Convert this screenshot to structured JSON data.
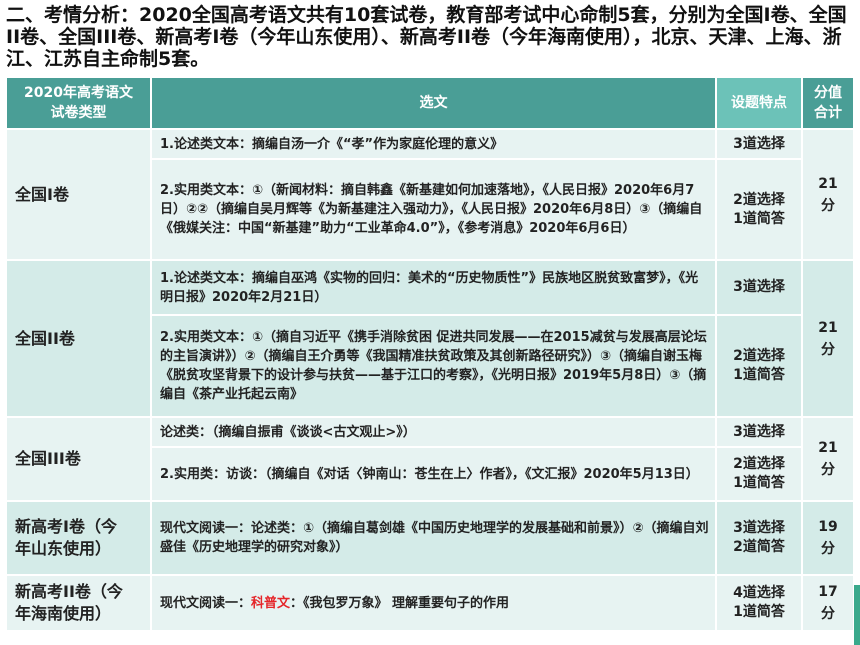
{
  "heading": "二、考情分析：2020全国高考语文共有10套试卷，教育部考试中心命制5套，分别为全国Ⅰ卷、全国II卷、全国III卷、新高考Ⅰ卷（今年山东使用）、新高考II卷（今年海南使用），北京、天津、上海、浙江、江苏自主命制5套。",
  "table": {
    "headers": {
      "type_line1": "2020年高考语文",
      "type_line2": "试卷类型",
      "selection": "选文",
      "feature": "设题特点",
      "score_line1": "分值",
      "score_line2": "合计"
    },
    "r1": {
      "type": "全国Ⅰ卷",
      "score_value": "21",
      "score_unit": "分",
      "a_text": "1.论述类文本：摘编自汤一介《“孝”作为家庭伦理的意义》",
      "a_feat": "3道选择",
      "b_text": "2.实用类文本：①（新闻材料：摘自韩鑫《新基建如何加速落地》，《人民日报》2020年6月7日）②②（摘编自吴月辉等《为新基建注入强动力》，《人民日报》2020年6月8日）③（摘编自《俄媒关注：中国“新基建”助力“工业革命4.0”》，《参考消息》2020年6月6日）",
      "b_feat1": "2道选择",
      "b_feat2": "1道简答"
    },
    "r2": {
      "type": "全国II卷",
      "score_value": "21",
      "score_unit": "分",
      "a_text": "1.论述类文本：摘编自巫鸿《实物的回归：美术的“历史物质性”》民族地区脱贫致富梦》，《光明日报》2020年2月21日）",
      "a_feat": "3道选择",
      "b_text": "2.实用类文本：①（摘自习近平《携手消除贫困 促进共同发展——在2015减贫与发展高层论坛的主旨演讲》）②（摘编自王介勇等《我国精准扶贫政策及其创新路径研究》）③（摘编自谢玉梅《脱贫攻坚背景下的设计参与扶贫——基于江口的考察》，《光明日报》2019年5月8日）③（摘编自《茶产业托起云南》",
      "b_feat1": "2道选择",
      "b_feat2": "1道简答"
    },
    "r3": {
      "type": "全国III卷",
      "score_value": "21",
      "score_unit": "分",
      "a_text": "论述类：（摘编自振甫《谈谈<古文观止>》）",
      "a_feat": "3道选择",
      "b_text": "2.实用类：访谈：（摘编自《对话〈钟南山：苍生在上〉作者》，《文汇报》2020年5月13日）",
      "b_feat1": "2道选择",
      "b_feat2": "1道简答"
    },
    "r4": {
      "type_line1": "新高考Ⅰ卷（今",
      "type_line2": "年山东使用）",
      "score_value": "19",
      "score_unit": "分",
      "a_text": "现代文阅读一：论述类：①（摘编自葛剑雄《中国历史地理学的发展基础和前景》）②（摘编自刘盛佳《历史地理学的研究对象》）",
      "a_feat1": "3道选择",
      "a_feat2": "2道简答"
    },
    "r5": {
      "type_line1": "新高考II卷（今",
      "type_line2": "年海南使用）",
      "score_value": "17",
      "score_unit": "分",
      "a_prefix": "现代文阅读一：",
      "a_highlight": "科普文",
      "a_suffix": "：《我包罗万象》 理解重要句子的作用",
      "a_feat1": "4道选择",
      "a_feat2": "1道简答"
    }
  },
  "colors": {
    "header_bg": "#4a9e96",
    "header_feature_bg": "#6cc2b8",
    "row_light": "#e7f3f2",
    "row_dark": "#d4ebe8",
    "highlight": "#e5262a"
  }
}
